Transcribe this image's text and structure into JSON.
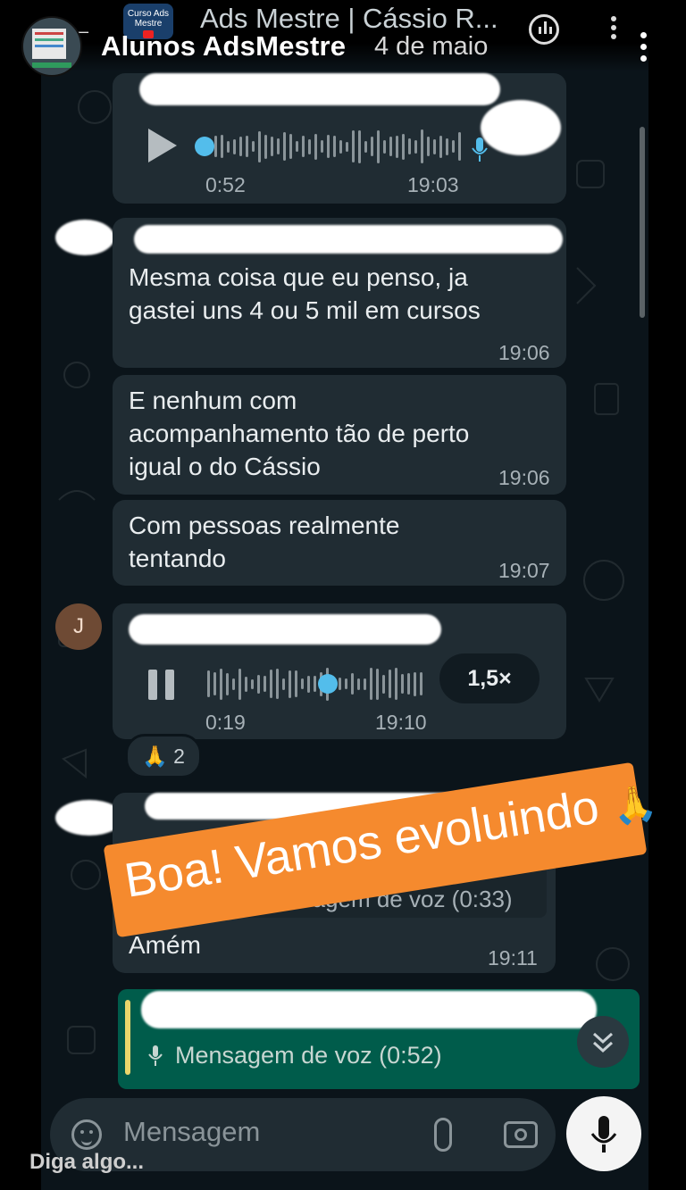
{
  "story": {
    "name": "Alunos AdsMestre",
    "date": "4 de maio",
    "reply_placeholder": "Diga algo..."
  },
  "header": {
    "group_name": "Ads Mestre | Cássio R...",
    "avatar_text": "Curso Ads Mestre"
  },
  "messages": [
    {
      "type": "voice",
      "duration": "0:52",
      "time": "19:03",
      "icon": "play-icon"
    },
    {
      "type": "text",
      "lines": [
        "Mesma coisa que eu penso, ja",
        "gastei uns 4 ou 5 mil em cursos"
      ],
      "time": "19:06"
    },
    {
      "type": "text",
      "lines": [
        "E nenhum com",
        "acompanhamento tão de perto",
        "igual o do Cássio"
      ],
      "time": "19:06"
    },
    {
      "type": "text",
      "lines": [
        "Com pessoas realmente",
        "tentando"
      ],
      "time": "19:07"
    },
    {
      "type": "voice",
      "avatar_initial": "J",
      "position": "0:19",
      "time": "19:10",
      "speed": "1,5×",
      "progress": 0.55,
      "reaction_emoji": "🙏",
      "reaction_count": "2"
    },
    {
      "type": "reply",
      "quoted": "Mensagem de voz (0:33)",
      "text": "Amém",
      "time": "19:11"
    }
  ],
  "sticker": {
    "text": "Boa! Vamos evoluindo",
    "emoji": "🙏",
    "color": "#f58a2e"
  },
  "quote_preview": {
    "text": "Mensagem de voz (0:52)"
  },
  "input": {
    "placeholder": "Mensagem"
  }
}
